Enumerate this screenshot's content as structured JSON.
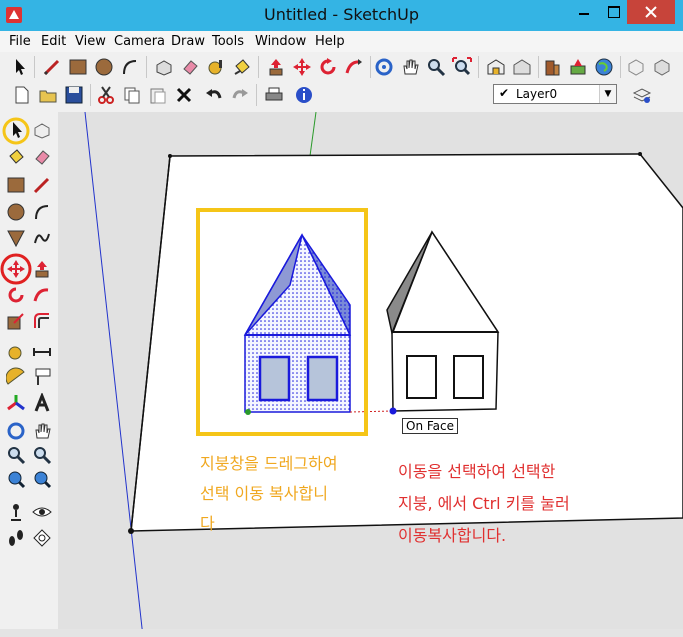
{
  "window": {
    "title": "Untitled - SketchUp"
  },
  "menu": {
    "items": [
      "File",
      "Edit",
      "View",
      "Camera",
      "Draw",
      "Tools",
      "Window",
      "Help"
    ]
  },
  "layer": {
    "selected": "Layer0"
  },
  "viewport": {
    "tooltip": "On Face",
    "annotation_left": [
      "지붕창을 드레그하여",
      "선택 이동 복사합니",
      "다"
    ],
    "annotation_right": [
      "이동을 선택하여 선택한",
      "지붕, 에서 Ctrl 키를 눌러",
      "이동복사합니다."
    ]
  },
  "colors": {
    "title_bar": "#34b4e4",
    "highlight_yellow": "#f5c518",
    "annotation_yellow": "#f0a820",
    "annotation_red": "#e03030",
    "selection_blue": "#1a1adc",
    "close_red": "#c7443a"
  }
}
